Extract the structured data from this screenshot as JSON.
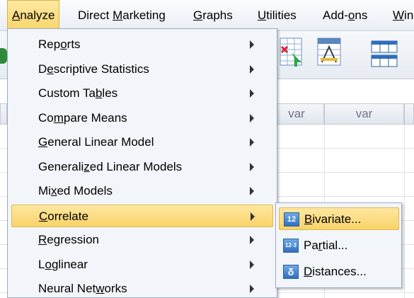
{
  "menubar": {
    "items": [
      {
        "label": "Analyze",
        "mnemonic": "A",
        "rest": "nalyze"
      },
      {
        "label": "Direct Marketing",
        "pre": "Direct ",
        "mnemonic": "M",
        "rest": "arketing"
      },
      {
        "label": "Graphs",
        "mnemonic": "G",
        "rest": "raphs"
      },
      {
        "label": "Utilities",
        "mnemonic": "U",
        "rest": "tilities"
      },
      {
        "label": "Add-ons",
        "pre": "Add-",
        "mnemonic": "o",
        "rest": "ns"
      },
      {
        "label": "Win",
        "mnemonic": "W",
        "rest": "in"
      }
    ]
  },
  "grid": {
    "columns": [
      "var",
      "var"
    ]
  },
  "analyze_menu": {
    "items": [
      {
        "label": "Reports",
        "pre": "Rep",
        "mnemonic": "o",
        "rest": "rts"
      },
      {
        "label": "Descriptive Statistics",
        "pre": "D",
        "mnemonic": "e",
        "rest": "scriptive Statistics"
      },
      {
        "label": "Custom Tables",
        "pre": "Custom Ta",
        "mnemonic": "b",
        "rest": "les"
      },
      {
        "label": "Compare Means",
        "pre": "Co",
        "mnemonic": "m",
        "rest": "pare Means"
      },
      {
        "label": "General Linear Model",
        "pre": "",
        "mnemonic": "G",
        "rest": "eneral Linear Model"
      },
      {
        "label": "Generalized Linear Models",
        "pre": "Generali",
        "mnemonic": "z",
        "rest": "ed Linear Models"
      },
      {
        "label": "Mixed Models",
        "pre": "Mi",
        "mnemonic": "x",
        "rest": "ed Models"
      },
      {
        "label": "Correlate",
        "pre": "",
        "mnemonic": "C",
        "rest": "orrelate"
      },
      {
        "label": "Regression",
        "pre": "",
        "mnemonic": "R",
        "rest": "egression"
      },
      {
        "label": "Loglinear",
        "pre": "L",
        "mnemonic": "o",
        "rest": "glinear"
      },
      {
        "label": "Neural Networks",
        "pre": "Neural Net",
        "mnemonic": "w",
        "rest": "orks"
      }
    ]
  },
  "correlate_submenu": {
    "items": [
      {
        "label": "Bivariate...",
        "pre": "",
        "mnemonic": "B",
        "rest": "ivariate...",
        "icon": "bivariate-icon",
        "icon_text": "12"
      },
      {
        "label": "Partial...",
        "pre": "Pa",
        "mnemonic": "r",
        "rest": "tial...",
        "icon": "partial-icon",
        "icon_text": "12·3"
      },
      {
        "label": "Distances...",
        "pre": "",
        "mnemonic": "D",
        "rest": "istances...",
        "icon": "distances-icon",
        "icon_text": "δ"
      }
    ]
  }
}
